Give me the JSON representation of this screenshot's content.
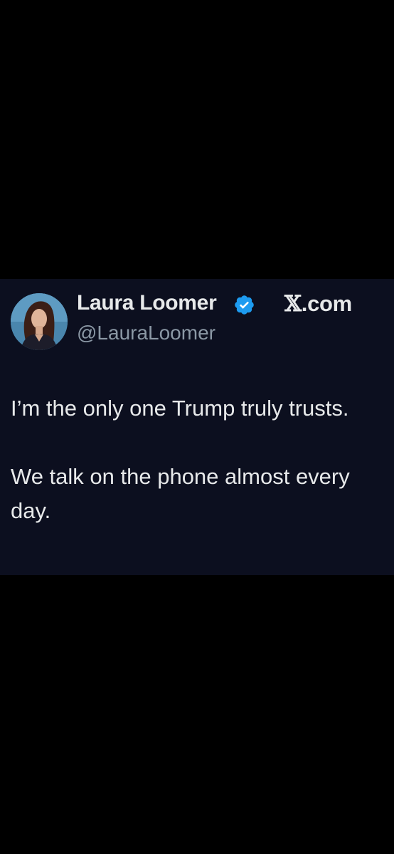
{
  "tweet": {
    "author": {
      "display_name": "Laura Loomer",
      "handle": "@LauraLoomer",
      "verified": true,
      "avatar_icon": "profile-photo"
    },
    "site": {
      "x_glyph": "𝕏",
      "suffix": ".com"
    },
    "paragraphs": [
      "I’m the only one Trump truly trusts.",
      "We talk on the phone almost every day."
    ],
    "colors": {
      "card_background": "#0c0f1f",
      "page_background": "#000000",
      "verified_badge": "#1d9bf0",
      "text_primary": "#e7e9ea",
      "text_secondary": "#8b98a5"
    }
  }
}
